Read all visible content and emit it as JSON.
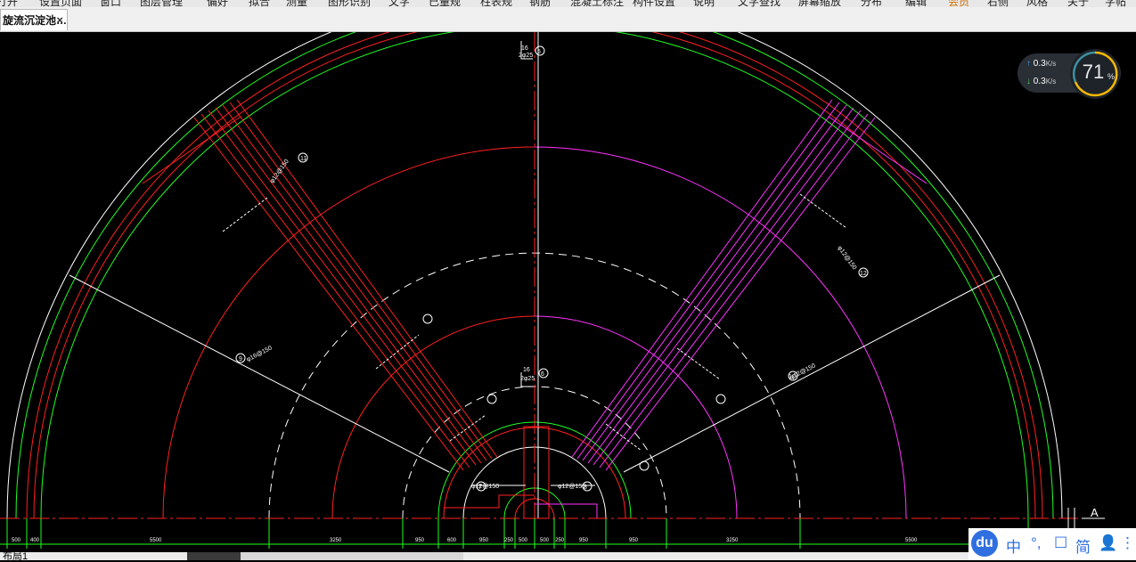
{
  "menu": {
    "items": [
      "打开",
      "设置页面",
      "窗口",
      "图层管理",
      "偏好",
      "拟合",
      "测量",
      "图形识别",
      "文字",
      "已量规",
      "柱表规",
      "钢筋",
      "混凝土标注",
      "构件设置",
      "说明",
      "文字查找",
      "屏幕缩放",
      "分布",
      "编辑",
      "会员",
      "右侧",
      "风格",
      "关于",
      "字帖"
    ]
  },
  "tab": {
    "label": "旋流沉淀池…",
    "close": "×"
  },
  "net_monitor": {
    "upload": "0.3",
    "download": "0.3",
    "unit": "K/s",
    "percent": "71",
    "percent_unit": "%"
  },
  "drawing": {
    "axis_mark": "A",
    "dimensions": [
      "500",
      "400",
      "5500",
      "3250",
      "950",
      "600",
      "950",
      "250",
      "500",
      "500",
      "250",
      "950",
      "950",
      "3250",
      "5500"
    ],
    "top_tag": {
      "top": "16",
      "bottom": "2φ25",
      "num": "5"
    },
    "mid_tag": {
      "top": "16",
      "bottom": "2φ25",
      "num": "6"
    },
    "callouts": [
      {
        "text": "φ12@150",
        "num": "7"
      },
      {
        "text": "φ12@150",
        "num": "8"
      },
      {
        "text": "φ16@150",
        "num": "9"
      },
      {
        "text": "φ12@150",
        "num": "10"
      },
      {
        "text": "φ12@150",
        "num": "11"
      },
      {
        "text": "φ12@150",
        "num": "12"
      }
    ]
  },
  "colors": {
    "red": "#ff2020",
    "green": "#20ff20",
    "magenta": "#ff33ff",
    "white": "#ffffff",
    "accent": "#2f6fe0"
  },
  "status": {
    "layout_tab": "布局1",
    "edit_icon": "pencil-icon"
  },
  "ime": {
    "logo": "du",
    "items": [
      "中",
      "°,",
      "☐",
      "简",
      "👤",
      "⋮⋮"
    ]
  }
}
